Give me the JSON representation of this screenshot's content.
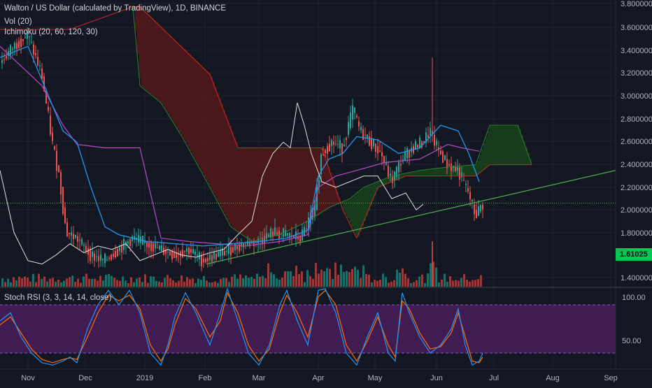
{
  "header": {
    "title": "Walton / US Dollar (calculated by TradingView), 1D, BINANCE",
    "vol_label": "Vol (20)",
    "ichimoku_label": "Ichimoku (20, 60, 120, 30)",
    "rsi_label": "Stoch RSI (3, 3, 14, 14, close)"
  },
  "last_price": "1.61025",
  "colors": {
    "background": "#131722",
    "up": "#26a69a",
    "down": "#ef5350",
    "cloud_red": "#5d1a1a",
    "cloud_green": "#1a4a1a",
    "trendline": "#4caf50",
    "rsi_band": "#4a1d5c",
    "rsi_k": "#2196f3",
    "rsi_d": "#ff6d00",
    "lagging": "#e0e0e0",
    "tenkan": "#2196f3",
    "kijun": "#ab47bc",
    "price_badge": "#00c853"
  },
  "chart_data": [
    {
      "type": "line",
      "title": "Walton / US Dollar (calculated by TradingView), 1D, BINANCE",
      "x_ticks": [
        "Nov",
        "Dec",
        "2019",
        "Feb",
        "Mar",
        "Apr",
        "May",
        "Jun",
        "Jul",
        "Aug",
        "Sep"
      ],
      "y_ticks": [
        "3.800000",
        "3.600000",
        "3.400000",
        "3.200000",
        "3.000000",
        "2.800000",
        "2.600000",
        "2.400000",
        "2.200000",
        "2.000000",
        "1.800000",
        "1.400000"
      ],
      "ylim": [
        1.32,
        3.86
      ],
      "price_close": [
        [
          0,
          3.3
        ],
        [
          20,
          3.45
        ],
        [
          40,
          3.55
        ],
        [
          60,
          3.2
        ],
        [
          75,
          2.6
        ],
        [
          85,
          2.3
        ],
        [
          95,
          1.8
        ],
        [
          110,
          1.75
        ],
        [
          130,
          1.6
        ],
        [
          150,
          1.55
        ],
        [
          170,
          1.65
        ],
        [
          190,
          1.75
        ],
        [
          210,
          1.7
        ],
        [
          230,
          1.65
        ],
        [
          250,
          1.6
        ],
        [
          270,
          1.65
        ],
        [
          290,
          1.55
        ],
        [
          310,
          1.6
        ],
        [
          330,
          1.65
        ],
        [
          350,
          1.7
        ],
        [
          370,
          1.72
        ],
        [
          390,
          1.8
        ],
        [
          410,
          1.78
        ],
        [
          430,
          1.75
        ],
        [
          450,
          2.0
        ],
        [
          460,
          2.5
        ],
        [
          475,
          2.6
        ],
        [
          490,
          2.55
        ],
        [
          505,
          2.9
        ],
        [
          515,
          2.7
        ],
        [
          530,
          2.6
        ],
        [
          545,
          2.5
        ],
        [
          560,
          2.25
        ],
        [
          575,
          2.45
        ],
        [
          590,
          2.55
        ],
        [
          605,
          2.6
        ],
        [
          615,
          2.7
        ],
        [
          625,
          2.55
        ],
        [
          640,
          2.4
        ],
        [
          655,
          2.35
        ],
        [
          670,
          2.15
        ],
        [
          680,
          1.95
        ],
        [
          690,
          2.05
        ]
      ],
      "volume_note": "Vol (20)",
      "ichimoku_lines": {
        "lagging_span": [
          [
            0,
            2.35
          ],
          [
            20,
            1.8
          ],
          [
            40,
            1.55
          ],
          [
            60,
            1.52
          ],
          [
            80,
            1.6
          ],
          [
            100,
            1.7
          ],
          [
            120,
            1.62
          ],
          [
            140,
            1.68
          ],
          [
            160,
            1.65
          ],
          [
            180,
            1.7
          ],
          [
            200,
            1.55
          ],
          [
            220,
            1.6
          ],
          [
            240,
            1.65
          ],
          [
            260,
            1.6
          ],
          [
            280,
            1.58
          ],
          [
            300,
            1.62
          ],
          [
            320,
            1.65
          ],
          [
            340,
            1.78
          ],
          [
            360,
            1.9
          ],
          [
            375,
            2.3
          ],
          [
            390,
            2.5
          ],
          [
            405,
            2.6
          ],
          [
            415,
            2.55
          ],
          [
            425,
            2.95
          ],
          [
            435,
            2.75
          ],
          [
            445,
            2.5
          ],
          [
            460,
            2.25
          ],
          [
            480,
            2.2
          ],
          [
            500,
            2.25
          ],
          [
            520,
            2.3
          ],
          [
            540,
            2.3
          ],
          [
            560,
            2.1
          ],
          [
            580,
            2.15
          ],
          [
            595,
            2.0
          ],
          [
            605,
            2.05
          ]
        ],
        "tenkan": [
          [
            0,
            3.35
          ],
          [
            40,
            3.45
          ],
          [
            70,
            3.0
          ],
          [
            90,
            2.7
          ],
          [
            110,
            2.6
          ],
          [
            130,
            2.2
          ],
          [
            150,
            1.85
          ],
          [
            170,
            1.78
          ],
          [
            210,
            1.72
          ],
          [
            250,
            1.7
          ],
          [
            290,
            1.68
          ],
          [
            330,
            1.7
          ],
          [
            370,
            1.72
          ],
          [
            410,
            1.75
          ],
          [
            440,
            1.82
          ],
          [
            455,
            2.3
          ],
          [
            470,
            2.45
          ],
          [
            490,
            2.5
          ],
          [
            510,
            2.65
          ],
          [
            540,
            2.62
          ],
          [
            570,
            2.5
          ],
          [
            600,
            2.55
          ],
          [
            630,
            2.75
          ],
          [
            655,
            2.7
          ],
          [
            670,
            2.5
          ],
          [
            685,
            2.25
          ]
        ],
        "kijun": [
          [
            0,
            3.45
          ],
          [
            60,
            3.1
          ],
          [
            90,
            2.75
          ],
          [
            110,
            2.58
          ],
          [
            150,
            2.55
          ],
          [
            200,
            2.55
          ],
          [
            230,
            1.75
          ],
          [
            270,
            1.72
          ],
          [
            310,
            1.7
          ],
          [
            350,
            1.68
          ],
          [
            400,
            1.72
          ],
          [
            440,
            1.78
          ],
          [
            455,
            2.2
          ],
          [
            480,
            2.3
          ],
          [
            510,
            2.35
          ],
          [
            550,
            2.42
          ],
          [
            600,
            2.45
          ],
          [
            640,
            2.58
          ],
          [
            660,
            2.55
          ],
          [
            685,
            2.52
          ]
        ],
        "senkou_a": [
          [
            190,
            3.8
          ],
          [
            200,
            3.1
          ],
          [
            230,
            2.95
          ],
          [
            260,
            2.65
          ],
          [
            300,
            2.2
          ],
          [
            330,
            1.85
          ],
          [
            360,
            1.72
          ],
          [
            400,
            1.78
          ],
          [
            440,
            1.9
          ],
          [
            470,
            2.02
          ],
          [
            500,
            2.1
          ],
          [
            520,
            2.2
          ],
          [
            560,
            2.3
          ],
          [
            600,
            2.35
          ],
          [
            640,
            2.38
          ],
          [
            680,
            2.4
          ],
          [
            700,
            2.75
          ],
          [
            740,
            2.75
          ],
          [
            760,
            2.4
          ]
        ],
        "senkou_b": [
          [
            0,
            3.6
          ],
          [
            100,
            3.6
          ],
          [
            190,
            3.8
          ],
          [
            200,
            3.8
          ],
          [
            300,
            3.2
          ],
          [
            340,
            2.55
          ],
          [
            400,
            2.55
          ],
          [
            460,
            2.55
          ],
          [
            490,
            2.0
          ],
          [
            510,
            1.75
          ],
          [
            540,
            2.2
          ],
          [
            580,
            2.3
          ],
          [
            640,
            2.3
          ],
          [
            680,
            2.3
          ],
          [
            700,
            2.4
          ],
          [
            760,
            2.4
          ]
        ]
      },
      "horizontal_level": 2.06,
      "trendline": {
        "from": [
          295,
          1.52
        ],
        "to": [
          880,
          2.35
        ]
      }
    },
    {
      "type": "line",
      "title": "Stoch RSI (3, 3, 14, 14, close)",
      "y_ticks": [
        "100.00",
        "50.00"
      ],
      "ylim": [
        0,
        100
      ],
      "band": [
        20,
        80
      ],
      "series": [
        {
          "values": [
            [
              0,
              60
            ],
            [
              15,
              70
            ],
            [
              30,
              40
            ],
            [
              45,
              20
            ],
            [
              60,
              8
            ],
            [
              75,
              5
            ],
            [
              90,
              10
            ],
            [
              100,
              15
            ],
            [
              110,
              8
            ],
            [
              125,
              50
            ],
            [
              140,
              80
            ],
            [
              155,
              98
            ],
            [
              170,
              80
            ],
            [
              185,
              98
            ],
            [
              200,
              70
            ],
            [
              215,
              20
            ],
            [
              230,
              5
            ],
            [
              240,
              30
            ],
            [
              250,
              65
            ],
            [
              265,
              95
            ],
            [
              280,
              70
            ],
            [
              300,
              30
            ],
            [
              315,
              70
            ],
            [
              325,
              100
            ],
            [
              340,
              60
            ],
            [
              355,
              20
            ],
            [
              370,
              5
            ],
            [
              385,
              30
            ],
            [
              400,
              80
            ],
            [
              410,
              98
            ],
            [
              425,
              60
            ],
            [
              440,
              30
            ],
            [
              455,
              98
            ],
            [
              465,
              100
            ],
            [
              480,
              70
            ],
            [
              495,
              20
            ],
            [
              510,
              5
            ],
            [
              525,
              40
            ],
            [
              540,
              70
            ],
            [
              555,
              20
            ],
            [
              565,
              10
            ],
            [
              575,
              95
            ],
            [
              585,
              70
            ],
            [
              600,
              40
            ],
            [
              615,
              20
            ],
            [
              630,
              30
            ],
            [
              645,
              50
            ],
            [
              655,
              75
            ],
            [
              665,
              30
            ],
            [
              675,
              5
            ],
            [
              685,
              10
            ],
            [
              690,
              20
            ]
          ]
        },
        {
          "values": [
            [
              0,
              55
            ],
            [
              15,
              65
            ],
            [
              30,
              45
            ],
            [
              45,
              25
            ],
            [
              60,
              12
            ],
            [
              75,
              8
            ],
            [
              90,
              12
            ],
            [
              100,
              14
            ],
            [
              110,
              12
            ],
            [
              125,
              40
            ],
            [
              140,
              70
            ],
            [
              155,
              92
            ],
            [
              170,
              85
            ],
            [
              185,
              92
            ],
            [
              200,
              75
            ],
            [
              215,
              30
            ],
            [
              230,
              10
            ],
            [
              240,
              25
            ],
            [
              250,
              55
            ],
            [
              265,
              88
            ],
            [
              280,
              75
            ],
            [
              300,
              40
            ],
            [
              315,
              60
            ],
            [
              325,
              95
            ],
            [
              340,
              70
            ],
            [
              355,
              30
            ],
            [
              370,
              10
            ],
            [
              385,
              25
            ],
            [
              400,
              70
            ],
            [
              410,
              92
            ],
            [
              425,
              70
            ],
            [
              440,
              40
            ],
            [
              455,
              90
            ],
            [
              465,
              98
            ],
            [
              480,
              80
            ],
            [
              495,
              30
            ],
            [
              510,
              10
            ],
            [
              525,
              35
            ],
            [
              540,
              65
            ],
            [
              555,
              30
            ],
            [
              565,
              15
            ],
            [
              575,
              85
            ],
            [
              585,
              75
            ],
            [
              600,
              45
            ],
            [
              615,
              25
            ],
            [
              630,
              28
            ],
            [
              645,
              45
            ],
            [
              655,
              70
            ],
            [
              665,
              40
            ],
            [
              675,
              10
            ],
            [
              685,
              8
            ],
            [
              690,
              15
            ]
          ]
        }
      ]
    }
  ]
}
